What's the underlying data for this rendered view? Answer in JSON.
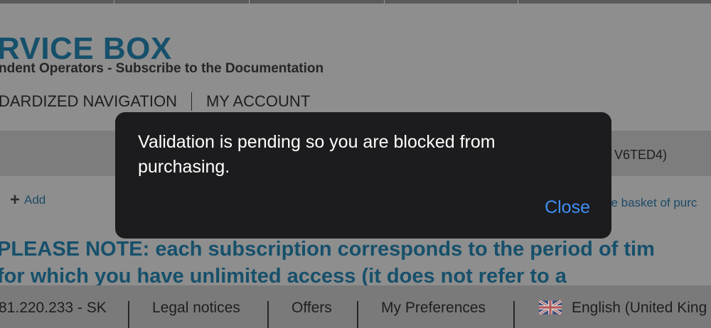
{
  "header": {
    "brand": "RVICE BOX",
    "subtitle": "ndent Operators - Subscribe to the Documentation",
    "nav": [
      "DARDIZED NAVIGATION",
      "MY ACCOUNT"
    ]
  },
  "band": {
    "text": "V6TED4)"
  },
  "actions": {
    "add_label": "Add",
    "basket_label": "he basket of purc"
  },
  "notice": {
    "line1": "PLEASE NOTE: each subscription corresponds to the period of tim",
    "line2": "for which you have unlimited access (it does not refer to a"
  },
  "footer": {
    "ip": "81.220.233 - SK",
    "legal": "Legal notices",
    "offers": "Offers",
    "preferences": "My Preferences",
    "language": "English (United King"
  },
  "dialog": {
    "message": "Validation is pending so you are blocked from purchasing.",
    "close_label": "Close"
  },
  "colors": {
    "brand": "#16506b",
    "dialog_bg": "#1c1c1e",
    "dialog_link": "#3d8ff4",
    "overlay_bg": "#8e8e8e"
  },
  "icons": {
    "add": "plus-icon",
    "language": "uk-flag-icon"
  }
}
